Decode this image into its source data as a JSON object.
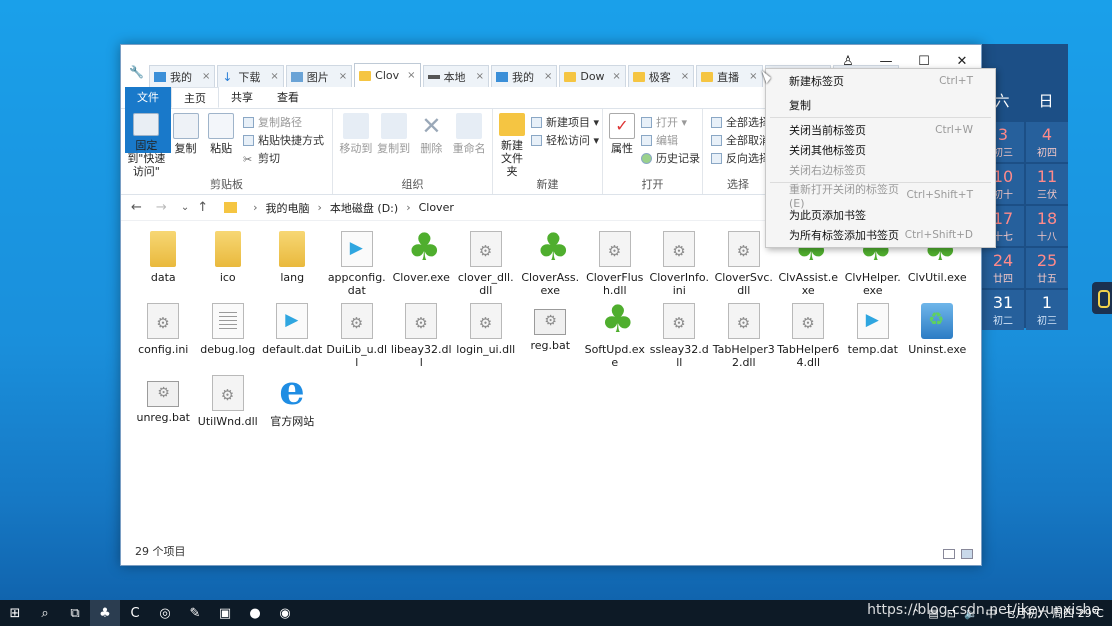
{
  "calendar": {
    "headers": [
      "六",
      "日"
    ],
    "cells": [
      {
        "d": "3",
        "l": "初三",
        "weekend": true
      },
      {
        "d": "4",
        "l": "初四",
        "weekend": true
      },
      {
        "d": "10",
        "l": "初十",
        "weekend": true
      },
      {
        "d": "11",
        "l": "三伏",
        "weekend": true
      },
      {
        "d": "17",
        "l": "十七",
        "weekend": true
      },
      {
        "d": "18",
        "l": "十八",
        "weekend": true
      },
      {
        "d": "24",
        "l": "廿四",
        "weekend": true
      },
      {
        "d": "25",
        "l": "廿五",
        "weekend": true
      },
      {
        "d": "31",
        "l": "初二",
        "weekend": false
      },
      {
        "d": "1",
        "l": "初三",
        "weekend": false
      }
    ]
  },
  "window": {
    "tabs": [
      {
        "label": "我的",
        "icon": "pc-icon"
      },
      {
        "label": "下载",
        "icon": "download-icon"
      },
      {
        "label": "图片",
        "icon": "pictures-icon"
      },
      {
        "label": "Clov",
        "icon": "folder-icon",
        "active": true
      },
      {
        "label": "本地",
        "icon": "drive-icon"
      },
      {
        "label": "我的",
        "icon": "pc-icon"
      },
      {
        "label": "Dow",
        "icon": "folder-icon"
      },
      {
        "label": "极客",
        "icon": "folder-icon"
      },
      {
        "label": "直播",
        "icon": "folder-icon"
      },
      {
        "label": "Wor",
        "icon": "folder-icon"
      },
      {
        "label": "",
        "icon": "drive-icon"
      }
    ],
    "tab_close": "×",
    "controls": {
      "user": "♙",
      "minimize": "—",
      "maximize": "☐",
      "close": "✕"
    },
    "ribbon_tabs": {
      "file": "文件",
      "home": "主页",
      "share": "共享",
      "view": "查看"
    },
    "ribbon": {
      "clipboard": {
        "label": "剪贴板",
        "pin": "固定到\"快速访问\"",
        "copy": "复制",
        "paste": "粘贴",
        "copy_path": "复制路径",
        "paste_shortcut": "粘贴快捷方式",
        "cut": "剪切"
      },
      "organize": {
        "label": "组织",
        "move_to": "移动到",
        "copy_to": "复制到",
        "delete": "删除",
        "rename": "重命名"
      },
      "new": {
        "label": "新建",
        "new_folder": "新建\n文件夹",
        "new_item": "新建项目 ▾",
        "easy_access": "轻松访问 ▾"
      },
      "open": {
        "label": "打开",
        "properties": "属性",
        "open": "打开 ▾",
        "edit": "编辑",
        "history": "历史记录"
      },
      "select": {
        "label": "选择",
        "select_all": "全部选择",
        "select_none": "全部取消",
        "invert": "反向选择"
      }
    },
    "address": {
      "back": "←",
      "forward": "→",
      "recent": "⌄",
      "up": "↑",
      "crumbs": [
        "我的电脑",
        "本地磁盘 (D:)",
        "Clover"
      ],
      "sep": "›"
    },
    "files": [
      {
        "name": "data",
        "type": "folder"
      },
      {
        "name": "ico",
        "type": "folder"
      },
      {
        "name": "lang",
        "type": "folder"
      },
      {
        "name": "appconfig.dat",
        "type": "vcd"
      },
      {
        "name": "Clover.exe",
        "type": "clover"
      },
      {
        "name": "clover_dll.dll",
        "type": "gear"
      },
      {
        "name": "CloverAss.exe",
        "type": "clover"
      },
      {
        "name": "CloverFlush.dll",
        "type": "gear"
      },
      {
        "name": "CloverInfo.ini",
        "type": "gear"
      },
      {
        "name": "CloverSvc.dll",
        "type": "gear"
      },
      {
        "name": "ClvAssist.exe",
        "type": "clover"
      },
      {
        "name": "ClvHelper.exe",
        "type": "clover"
      },
      {
        "name": "ClvUtil.exe",
        "type": "clover"
      },
      {
        "name": "config.ini",
        "type": "gear"
      },
      {
        "name": "debug.log",
        "type": "doc"
      },
      {
        "name": "default.dat",
        "type": "vcd"
      },
      {
        "name": "DuiLib_u.dll",
        "type": "gear"
      },
      {
        "name": "libeay32.dll",
        "type": "gear"
      },
      {
        "name": "login_ui.dll",
        "type": "gear"
      },
      {
        "name": "reg.bat",
        "type": "bat"
      },
      {
        "name": "SoftUpd.exe",
        "type": "clover"
      },
      {
        "name": "ssleay32.dll",
        "type": "gear"
      },
      {
        "name": "TabHelper32.dll",
        "type": "gear"
      },
      {
        "name": "TabHelper64.dll",
        "type": "gear"
      },
      {
        "name": "temp.dat",
        "type": "vcd"
      },
      {
        "name": "Uninst.exe",
        "type": "uninst"
      },
      {
        "name": "unreg.bat",
        "type": "bat"
      },
      {
        "name": "UtilWnd.dll",
        "type": "gear"
      },
      {
        "name": "官方网站",
        "type": "ie"
      }
    ],
    "status": "29 个项目"
  },
  "context_menu": [
    {
      "label": "新建标签页",
      "shortcut": "Ctrl+T"
    },
    {
      "label": "复制",
      "shortcut": "",
      "space": true
    },
    {
      "sep": true
    },
    {
      "label": "关闭当前标签页",
      "shortcut": "Ctrl+W"
    },
    {
      "label": "关闭其他标签页",
      "shortcut": ""
    },
    {
      "label": "关闭右边标签页",
      "shortcut": "",
      "disabled": true
    },
    {
      "sep": true
    },
    {
      "label": "重新打开关闭的标签页(E)",
      "shortcut": "Ctrl+Shift+T",
      "disabled": true
    },
    {
      "label": "为此页添加书签",
      "shortcut": ""
    },
    {
      "label": "为所有标签添加书签页",
      "shortcut": "Ctrl+Shift+D"
    }
  ],
  "taskbar": {
    "icons": [
      "⊞",
      "⌕",
      "⧉",
      "♣",
      "C",
      "◎",
      "✎",
      "▣",
      "●",
      "◉"
    ],
    "tray": [
      "⌃",
      "▤",
      "⊡",
      "🔈",
      "中",
      "七月初六 周四 29℃"
    ]
  },
  "watermark": "https://blog.csdn.net/ikeyunxishe"
}
